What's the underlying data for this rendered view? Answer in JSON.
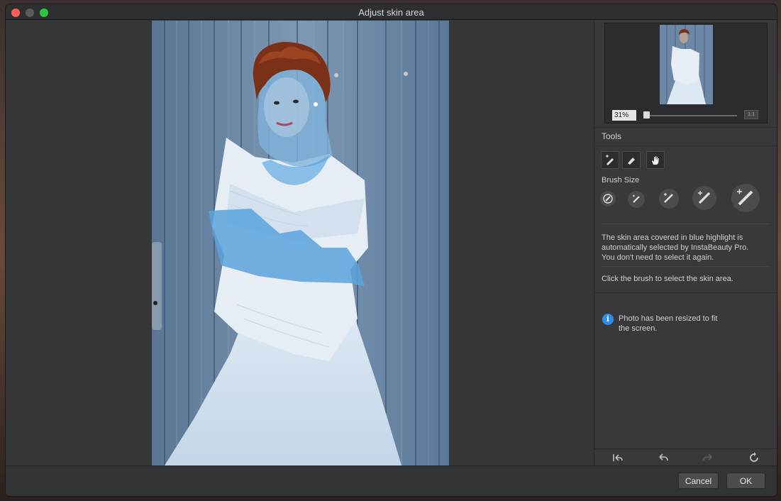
{
  "window": {
    "title": "Adjust skin area"
  },
  "navigator": {
    "zoom_value": "31%",
    "fit_label": "1:1"
  },
  "tools": {
    "heading": "Tools",
    "buttons": [
      {
        "icon": "brush-add-icon"
      },
      {
        "icon": "eraser-icon"
      },
      {
        "icon": "hand-pan-icon"
      }
    ],
    "brush_size_label": "Brush Size",
    "brush_sizes": [
      "xs",
      "s",
      "m",
      "l",
      "xl"
    ]
  },
  "info": {
    "description": "The skin area covered in blue highlight is\nautomatically selected by InstaBeauty Pro.\nYou don't need to select it again.",
    "instruction": "Click the brush to select the skin area.",
    "notice": "Photo has been resized to fit\nthe screen."
  },
  "history": {
    "buttons": [
      "undo-all-icon",
      "undo-icon",
      "redo-icon",
      "reset-icon"
    ]
  },
  "footer": {
    "cancel_label": "Cancel",
    "ok_label": "OK"
  },
  "colors": {
    "accent": "#2d8ee8",
    "skin_highlight": "#4a9fe0",
    "window_bg": "#353637"
  }
}
